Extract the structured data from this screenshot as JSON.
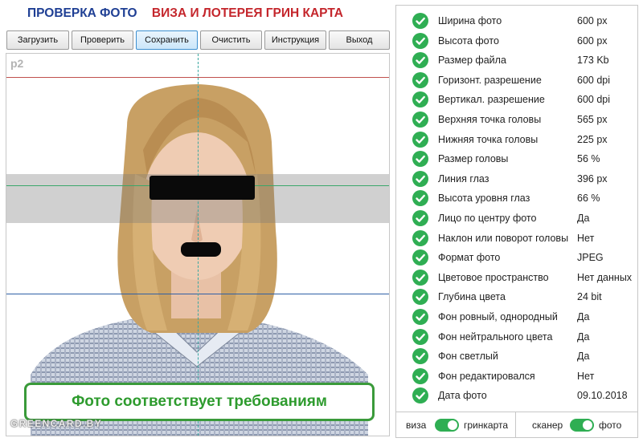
{
  "header": {
    "title_part1": "ПРОВЕРКА ФОТО",
    "title_part2": "ВИЗА И ЛОТЕРЕЯ ГРИН КАРТА"
  },
  "toolbar": {
    "buttons": [
      {
        "label": "Загрузить"
      },
      {
        "label": "Проверить"
      },
      {
        "label": "Сохранить"
      },
      {
        "label": "Очистить"
      },
      {
        "label": "Инструкция"
      },
      {
        "label": "Выход"
      }
    ]
  },
  "photo": {
    "profile_label": "p2",
    "status_message": "Фото соответствует требованиям",
    "watermark": "GREENCARD.BY"
  },
  "results": {
    "rows": [
      {
        "label": "Ширина фото",
        "value": "600 px"
      },
      {
        "label": "Высота фото",
        "value": "600 px"
      },
      {
        "label": "Размер файла",
        "value": "173 Kb"
      },
      {
        "label": "Горизонт. разрешение",
        "value": "600 dpi"
      },
      {
        "label": "Вертикал. разрешение",
        "value": "600 dpi"
      },
      {
        "label": "Верхняя точка головы",
        "value": "565 px"
      },
      {
        "label": "Нижняя точка головы",
        "value": "225 px"
      },
      {
        "label": "Размер головы",
        "value": "56 %"
      },
      {
        "label": "Линия глаз",
        "value": "396 px"
      },
      {
        "label": "Высота уровня глаз",
        "value": "66 %"
      },
      {
        "label": "Лицо по центру фото",
        "value": "Да"
      },
      {
        "label": "Наклон или поворот головы",
        "value": "Нет"
      },
      {
        "label": "Формат фото",
        "value": "JPEG"
      },
      {
        "label": "Цветовое пространство",
        "value": "Нет данных"
      },
      {
        "label": "Глубина цвета",
        "value": "24 bit"
      },
      {
        "label": "Фон ровный, однородный",
        "value": "Да"
      },
      {
        "label": "Фон нейтрального цвета",
        "value": "Да"
      },
      {
        "label": "Фон светлый",
        "value": "Да"
      },
      {
        "label": "Фон редактировался",
        "value": "Нет"
      },
      {
        "label": "Дата фото",
        "value": "09.10.2018"
      }
    ]
  },
  "bottom": {
    "toggle1_left": "виза",
    "toggle1_right": "гринкарта",
    "toggle2_left": "сканер",
    "toggle2_right": "фото"
  },
  "colors": {
    "accent_green": "#2fae53",
    "title_blue": "#1f3f94",
    "title_red": "#c4262c"
  }
}
